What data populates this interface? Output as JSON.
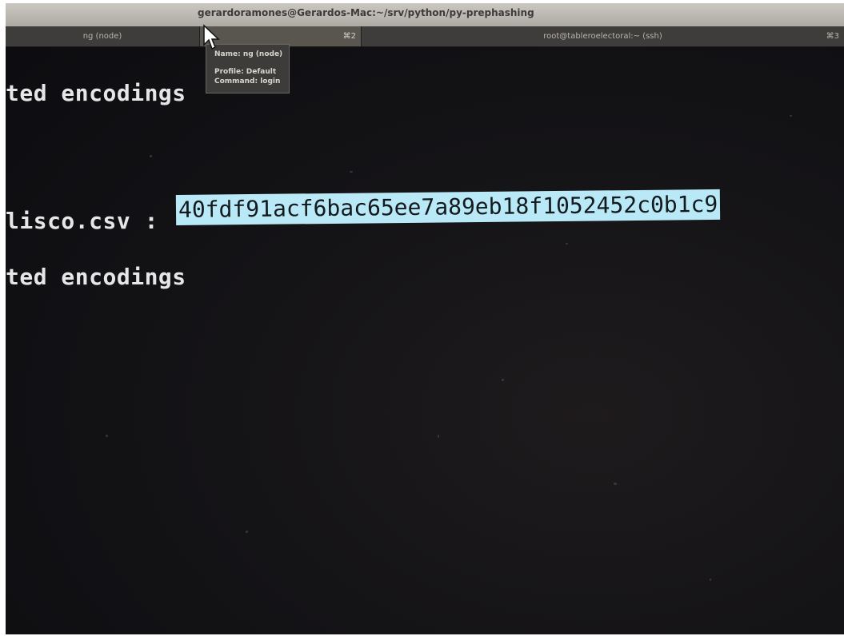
{
  "window": {
    "title": "gerardoramones@Gerardos-Mac:~/srv/python/py-prephashing"
  },
  "tabs": [
    {
      "label": "ng (node)",
      "shortcut": ""
    },
    {
      "label": "",
      "shortcut": "⌘2"
    },
    {
      "label": "root@tableroelectoral:~ (ssh)",
      "shortcut": "⌘3"
    }
  ],
  "tooltip": {
    "name": "Name: ng (node)",
    "profile": "Profile: Default",
    "command": "Command: login"
  },
  "terminal": {
    "line1": "ted encodings",
    "line2_prefix": "lisco.csv : ",
    "line2_hash": "40fdf91acf6bac65ee7a89eb18f1052452c0b1c9",
    "line3": "ted encodings"
  },
  "colors": {
    "terminal_bg": "#141316",
    "terminal_text": "#e6e6e6",
    "selection_bg": "#b9e9f7",
    "titlebar": "#bfbbb5",
    "tabbar": "#3f3d3b"
  }
}
